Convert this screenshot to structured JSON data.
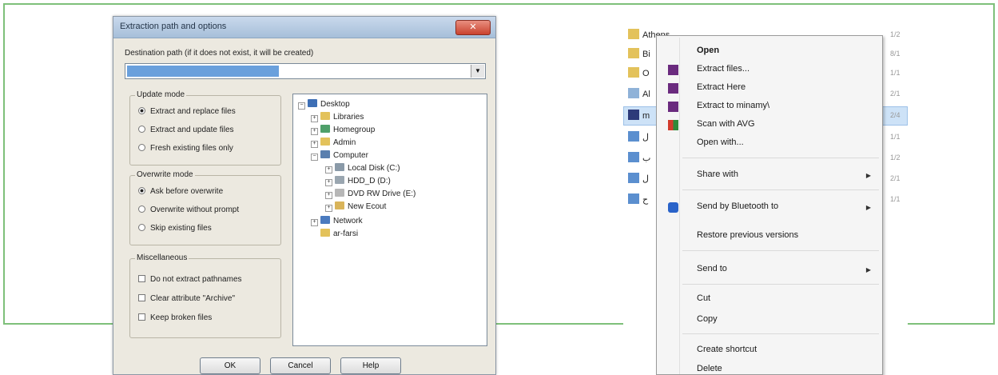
{
  "dialog": {
    "title": "Extraction path and options",
    "close": "✕",
    "destination_label": "Destination path (if it does not exist, it will be created)",
    "update_mode": {
      "title": "Update mode",
      "options": [
        "Extract and replace files",
        "Extract and update files",
        "Fresh existing files only"
      ]
    },
    "overwrite_mode": {
      "title": "Overwrite mode",
      "options": [
        "Ask before overwrite",
        "Overwrite without prompt",
        "Skip existing files"
      ]
    },
    "misc": {
      "title": "Miscellaneous",
      "options": [
        "Do not extract pathnames",
        "Clear attribute \"Archive\"",
        "Keep broken files"
      ]
    },
    "tree": [
      "Desktop",
      "Libraries",
      "Homegroup",
      "Admin",
      "Computer",
      "Local Disk (C:)",
      "HDD_D (D:)",
      "DVD RW Drive (E:)",
      "New Ecout",
      "Network",
      "ar-farsi"
    ],
    "buttons": {
      "ok": "OK",
      "cancel": "Cancel",
      "help": "Help"
    }
  },
  "explorer": {
    "files": [
      "Athens",
      "Bi",
      "O",
      "Al",
      "m",
      "ل",
      "ب",
      "ل",
      "ح"
    ],
    "column": [
      "1/2",
      "8/1",
      "1/1",
      "2/1",
      "2/4",
      "1/1",
      "1/2",
      "2/1",
      "1/1"
    ]
  },
  "context_menu": {
    "items": [
      "Open",
      "Extract files...",
      "Extract Here",
      "Extract to minamy\\",
      "Scan with AVG",
      "Open with...",
      "Share with",
      "Send by Bluetooth to",
      "Restore previous versions",
      "Send to",
      "Cut",
      "Copy",
      "Create shortcut",
      "Delete"
    ]
  }
}
